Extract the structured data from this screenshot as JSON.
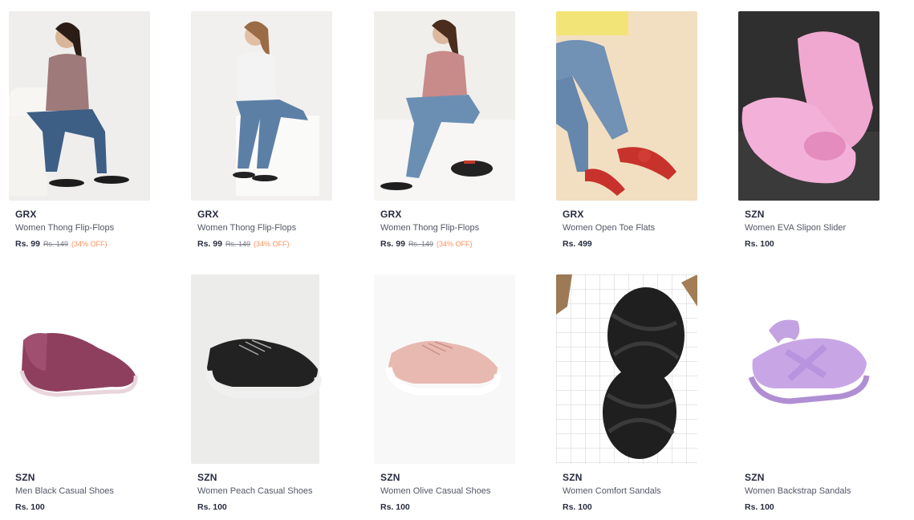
{
  "products": [
    {
      "brand": "GRX",
      "name": "Women Thong Flip-Flops",
      "price": "Rs. 99",
      "mrp": "Rs. 149",
      "discount": "(34% OFF)",
      "image": "woman-seated-chair-flipflops"
    },
    {
      "brand": "GRX",
      "name": "Women Thong Flip-Flops",
      "price": "Rs. 99",
      "mrp": "Rs. 149",
      "discount": "(34% OFF)",
      "image": "woman-seated-white-tee-flipflops"
    },
    {
      "brand": "GRX",
      "name": "Women Thong Flip-Flops",
      "price": "Rs. 99",
      "mrp": "Rs. 149",
      "discount": "(34% OFF)",
      "image": "woman-seated-pink-tee-flipflops"
    },
    {
      "brand": "GRX",
      "name": "Women Open Toe Flats",
      "price": "Rs. 499",
      "mrp": "",
      "discount": "",
      "image": "red-bow-flats"
    },
    {
      "brand": "SZN",
      "name": "Women EVA Slipon Slider",
      "price": "Rs. 100",
      "mrp": "",
      "discount": "",
      "image": "pink-eva-slider"
    },
    {
      "brand": "SZN",
      "name": "Men Black Casual Shoes",
      "price": "Rs. 100",
      "mrp": "",
      "discount": "",
      "image": "maroon-slipon-shoe"
    },
    {
      "brand": "SZN",
      "name": "Women Peach Casual Shoes",
      "price": "Rs. 100",
      "mrp": "",
      "discount": "",
      "image": "black-sneaker"
    },
    {
      "brand": "SZN",
      "name": "Women Olive Casual Shoes",
      "price": "Rs. 100",
      "mrp": "",
      "discount": "",
      "image": "peach-sneaker"
    },
    {
      "brand": "SZN",
      "name": "Women Comfort Sandals",
      "price": "Rs. 100",
      "mrp": "",
      "discount": "",
      "image": "black-comfort-sandals"
    },
    {
      "brand": "SZN",
      "name": "Women Backstrap Sandals",
      "price": "Rs. 100",
      "mrp": "",
      "discount": "",
      "image": "lilac-backstrap-sandals"
    }
  ],
  "colors": {
    "brand_text": "#282c3f",
    "name_text": "#535766",
    "mrp_text": "#7e818c",
    "discount_text": "#ff905a"
  }
}
